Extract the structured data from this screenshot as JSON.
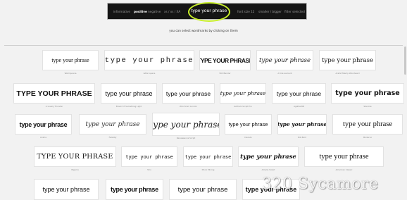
{
  "toolbar": {
    "items": {
      "informative": "informative",
      "positive": "positive",
      "negative": "negative",
      "sizes": "xs / xs / XA",
      "font_size": "font size 12",
      "smaller_bigger": "smaller / bigger",
      "filter": "filter selected"
    },
    "phrase": "type your phrase",
    "highlight_color": "#c8ef28"
  },
  "hint": "you can select wordmarks by clicking on them",
  "sample_text": "type your phrase",
  "samples": [
    {
      "text": "type your phrase",
      "caption": "Wetmpoena"
    },
    {
      "text": "type your phrase",
      "caption": "letter space"
    },
    {
      "text": "TYPE YOUR PHRASE",
      "caption": "Still Bender"
    },
    {
      "text": "type your phrase",
      "caption": "A tide we bent"
    },
    {
      "text": "type your phrase",
      "caption": "Arafat Stamp Woodward"
    },
    {
      "text": "TYPE YOUR PHRASE",
      "caption": "A Lovely Thunder"
    },
    {
      "text": "type your phrase",
      "caption": "Brook ST Something Light"
    },
    {
      "text": "type your phrase",
      "caption": "Winchrom Lincoln"
    },
    {
      "text": "type your phrase",
      "caption": "Gotham Script Pro"
    },
    {
      "text": "type your phrase",
      "caption": "Agatha BB"
    },
    {
      "text": "type your phrase",
      "caption": "Stencile"
    },
    {
      "text": "type your phrase",
      "caption": "Anima"
    },
    {
      "text": "type your phrase",
      "caption": "Fadelity"
    },
    {
      "text": "type your phrase",
      "caption": "Renaissance Script"
    },
    {
      "text": "type your phrase",
      "caption": "Dwinds"
    },
    {
      "text": "type your phrase",
      "caption": "Bib Bold"
    },
    {
      "text": "type your phrase",
      "caption": "Moderno"
    },
    {
      "text": "TYPE YOUR PHRASE",
      "caption": "Wgame"
    },
    {
      "text": "type your phrase",
      "caption": "Stru"
    },
    {
      "text": "type your phrase",
      "caption": "Mono Mining"
    },
    {
      "text": "type your phrase",
      "caption": "Amalie Script"
    },
    {
      "text": "type your phrase",
      "caption": "American Classic"
    },
    {
      "text": "type your phrase",
      "caption": ""
    },
    {
      "text": "type your phrase",
      "caption": ""
    },
    {
      "text": "type your phrase",
      "caption": ""
    },
    {
      "text": "type your phrase",
      "caption": ""
    }
  ],
  "watermark": "320 Sycamore"
}
